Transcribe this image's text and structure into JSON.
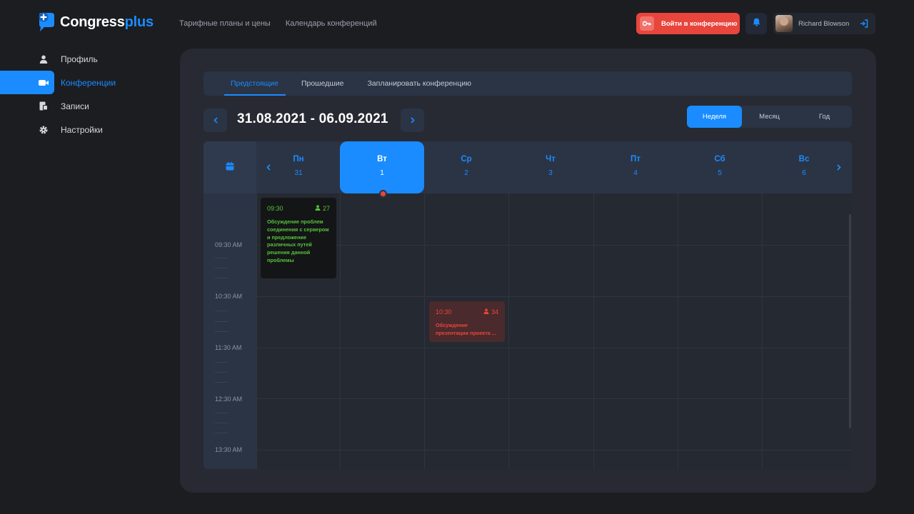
{
  "app": {
    "logo_main": "Congress",
    "logo_accent": "plus"
  },
  "top_nav": {
    "pricing": "Тарифные планы и цены",
    "calendar": "Календарь конференций"
  },
  "header": {
    "join_label": "Войти в конференцию",
    "user_name": "Richard Blowson"
  },
  "sidebar": {
    "items": [
      {
        "label": "Профиль",
        "icon": "user-icon"
      },
      {
        "label": "Конференции",
        "icon": "video-icon"
      },
      {
        "label": "Записи",
        "icon": "records-icon"
      },
      {
        "label": "Настройки",
        "icon": "gear-icon"
      }
    ],
    "active_index": 1
  },
  "tabs": {
    "upcoming": "Предстоящие",
    "past": "Прошедшие",
    "schedule": "Запланировать конференцию"
  },
  "date_range": "31.08.2021 - 06.09.2021",
  "view": {
    "week": "Неделя",
    "month": "Месяц",
    "year": "Год",
    "active": "week"
  },
  "days": [
    {
      "name": "Пн",
      "num": "31"
    },
    {
      "name": "Вт",
      "num": "1"
    },
    {
      "name": "Ср",
      "num": "2"
    },
    {
      "name": "Чт",
      "num": "3"
    },
    {
      "name": "Пт",
      "num": "4"
    },
    {
      "name": "Сб",
      "num": "5"
    },
    {
      "name": "Вс",
      "num": "6"
    }
  ],
  "times": [
    "09:30 AM",
    "10:30 AM",
    "11:30 AM",
    "12:30 AM",
    "13:30 AM"
  ],
  "events": [
    {
      "time": "09:30",
      "count": "27",
      "title": "Обсуждение проблем соединения с сервером и предложение различных путей решения данной проблемы",
      "day": "Пн"
    },
    {
      "time": "10:30",
      "count": "34",
      "title": "Обсуждение презентации проекта ...",
      "day": "Ср"
    }
  ],
  "colors": {
    "accent": "#1a8cff",
    "danger": "#e8453c",
    "success": "#56c23c",
    "panel": "#272a32"
  }
}
